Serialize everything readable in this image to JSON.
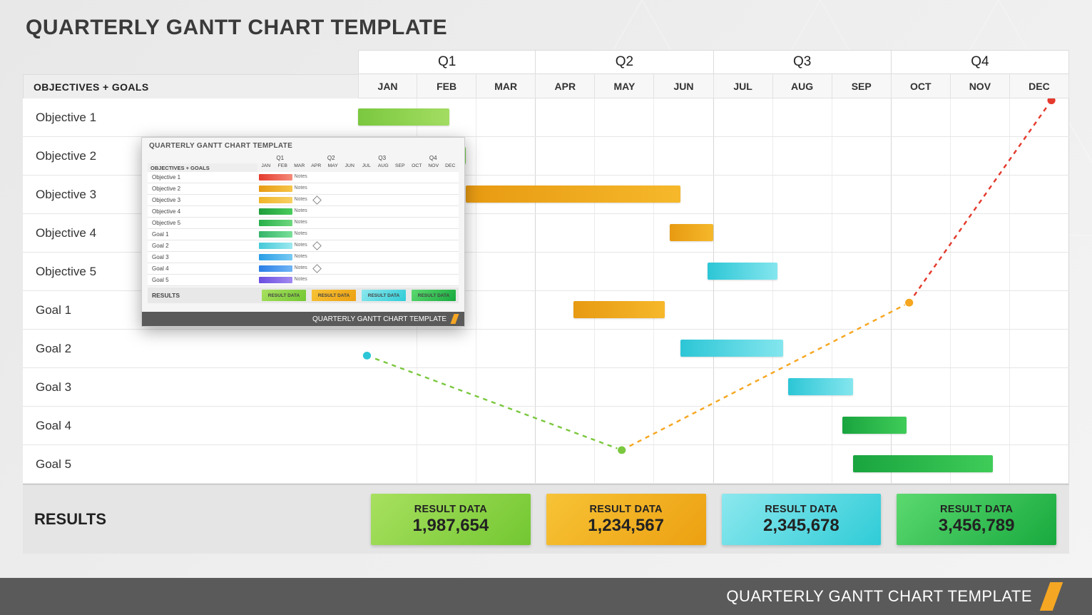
{
  "title": "QUARTERLY GANTT CHART TEMPLATE",
  "footer_title": "QUARTERLY GANTT CHART TEMPLATE",
  "header": {
    "quarters": [
      "Q1",
      "Q2",
      "Q3",
      "Q4"
    ],
    "months": [
      "JAN",
      "FEB",
      "MAR",
      "APR",
      "MAY",
      "JUN",
      "JUL",
      "AUG",
      "SEP",
      "OCT",
      "NOV",
      "DEC"
    ],
    "row_label_header": "OBJECTIVES + GOALS"
  },
  "rows": [
    {
      "label": "Objective 1",
      "bar": {
        "start": 0,
        "span": 1.7,
        "color": "c-green1"
      }
    },
    {
      "label": "Objective 2",
      "bar": {
        "start": 1.3,
        "span": 0.7,
        "color": "c-green2"
      }
    },
    {
      "label": "Objective 3",
      "bar": {
        "start": 2.0,
        "span": 4.0,
        "color": "c-orange"
      }
    },
    {
      "label": "Objective 4",
      "bar": {
        "start": 5.8,
        "span": 0.8,
        "color": "c-orange"
      }
    },
    {
      "label": "Objective 5",
      "bar": {
        "start": 6.5,
        "span": 1.3,
        "color": "c-cyan"
      }
    },
    {
      "label": "Goal 1",
      "bar": {
        "start": 4.0,
        "span": 1.7,
        "color": "c-orange"
      }
    },
    {
      "label": "Goal 2",
      "bar": {
        "start": 6.0,
        "span": 1.9,
        "color": "c-cyan"
      }
    },
    {
      "label": "Goal 3",
      "bar": {
        "start": 8.0,
        "span": 1.2,
        "color": "c-cyan"
      }
    },
    {
      "label": "Goal 4",
      "bar": {
        "start": 9.0,
        "span": 1.2,
        "color": "c-greenD"
      }
    },
    {
      "label": "Goal 5",
      "bar": {
        "start": 9.2,
        "span": 2.6,
        "color": "c-greenD"
      }
    }
  ],
  "results": {
    "label": "RESULTS",
    "boxes": [
      {
        "title": "RESULT DATA",
        "value": "1,987,654",
        "cls": "rb-green"
      },
      {
        "title": "RESULT DATA",
        "value": "1,234,567",
        "cls": "rb-orange"
      },
      {
        "title": "RESULT DATA",
        "value": "2,345,678",
        "cls": "rb-cyan"
      },
      {
        "title": "RESULT DATA",
        "value": "3,456,789",
        "cls": "rb-greenD"
      }
    ]
  },
  "trend_points": [
    {
      "month": 0.15,
      "row": 6.8,
      "color": "#2cc6d6"
    },
    {
      "month": 4.45,
      "row": 9.3,
      "color": "#7bc83f"
    },
    {
      "month": 9.3,
      "row": 5.4,
      "color": "#f6a61f"
    },
    {
      "month": 11.7,
      "row": 0.05,
      "color": "#e43b2e"
    }
  ],
  "thumb": {
    "title": "QUARTERLY GANTT CHART TEMPLATE",
    "footer": "QUARTERLY GANTT CHART TEMPLATE",
    "row_label_header": "OBJECTIVES + GOALS",
    "quarters": [
      "Q1",
      "Q2",
      "Q3",
      "Q4"
    ],
    "months": [
      "JAN",
      "FEB",
      "MAR",
      "APR",
      "MAY",
      "JUN",
      "JUL",
      "AUG",
      "SEP",
      "OCT",
      "NOV",
      "DEC"
    ],
    "rows": [
      {
        "label": "Objective 1",
        "bar": {
          "start": 0,
          "span": 2,
          "grad": "linear-gradient(90deg,#e43b2e,#f58a7a)"
        },
        "note": "Notes"
      },
      {
        "label": "Objective 2",
        "bar": {
          "start": 0,
          "span": 2,
          "grad": "linear-gradient(90deg,#e79a12,#f6c548)"
        },
        "note": "Notes"
      },
      {
        "label": "Objective 3",
        "bar": {
          "start": 0,
          "span": 2,
          "grad": "linear-gradient(90deg,#f0b428,#f7d063)"
        },
        "note": "Notes",
        "diamond": true
      },
      {
        "label": "Objective 4",
        "bar": {
          "start": 0,
          "span": 2,
          "grad": "linear-gradient(90deg,#1f9e3b,#49cc5c)"
        },
        "note": "Notes"
      },
      {
        "label": "Objective 5",
        "bar": {
          "start": 0,
          "span": 2,
          "grad": "linear-gradient(90deg,#27b04a,#6fd77e)"
        },
        "note": "Notes"
      },
      {
        "label": "Goal 1",
        "bar": {
          "start": 0,
          "span": 2,
          "grad": "linear-gradient(90deg,#35b56a,#7adf99)"
        },
        "note": "Notes"
      },
      {
        "label": "Goal 2",
        "bar": {
          "start": 0,
          "span": 2,
          "grad": "linear-gradient(90deg,#44c9d8,#9ce9ef)"
        },
        "note": "Notes",
        "diamond": true
      },
      {
        "label": "Goal 3",
        "bar": {
          "start": 0,
          "span": 2,
          "grad": "linear-gradient(90deg,#2a9ee6,#78caf3)"
        },
        "note": "Notes"
      },
      {
        "label": "Goal 4",
        "bar": {
          "start": 0,
          "span": 2,
          "grad": "linear-gradient(90deg,#2a7de6,#6fb4f5)"
        },
        "note": "Notes",
        "diamond": true
      },
      {
        "label": "Goal 5",
        "bar": {
          "start": 0,
          "span": 2,
          "grad": "linear-gradient(90deg,#6a4de0,#a28af0)"
        },
        "note": "Notes"
      }
    ],
    "results": {
      "label": "RESULTS",
      "boxes": [
        {
          "t": "RESULT DATA",
          "cls": "rb-green"
        },
        {
          "t": "RESULT DATA",
          "cls": "rb-orange"
        },
        {
          "t": "RESULT DATA",
          "cls": "rb-cyan"
        },
        {
          "t": "RESULT DATA",
          "cls": "rb-greenD"
        }
      ]
    }
  },
  "chart_data": {
    "type": "gantt",
    "time_axis": {
      "unit": "month",
      "labels": [
        "JAN",
        "FEB",
        "MAR",
        "APR",
        "MAY",
        "JUN",
        "JUL",
        "AUG",
        "SEP",
        "OCT",
        "NOV",
        "DEC"
      ],
      "range": [
        0,
        12
      ]
    },
    "quarters": [
      "Q1",
      "Q2",
      "Q3",
      "Q4"
    ],
    "tasks": [
      {
        "name": "Objective 1",
        "start": 0.0,
        "end": 1.7,
        "color": "#8ccf44"
      },
      {
        "name": "Objective 2",
        "start": 1.3,
        "end": 2.0,
        "color": "#4fb84f"
      },
      {
        "name": "Objective 3",
        "start": 2.0,
        "end": 6.0,
        "color": "#f1aa1d"
      },
      {
        "name": "Objective 4",
        "start": 5.8,
        "end": 6.6,
        "color": "#f1aa1d"
      },
      {
        "name": "Objective 5",
        "start": 6.5,
        "end": 7.8,
        "color": "#4bd3de"
      },
      {
        "name": "Goal 1",
        "start": 4.0,
        "end": 5.7,
        "color": "#f1aa1d"
      },
      {
        "name": "Goal 2",
        "start": 6.0,
        "end": 7.9,
        "color": "#4bd3de"
      },
      {
        "name": "Goal 3",
        "start": 8.0,
        "end": 9.2,
        "color": "#6ae0e9"
      },
      {
        "name": "Goal 4",
        "start": 9.0,
        "end": 10.2,
        "color": "#2fb64c"
      },
      {
        "name": "Goal 5",
        "start": 9.2,
        "end": 11.8,
        "color": "#2fb64c"
      }
    ],
    "results_per_quarter": [
      {
        "quarter": "Q1",
        "label": "RESULT DATA",
        "value": 1987654
      },
      {
        "quarter": "Q2",
        "label": "RESULT DATA",
        "value": 1234567
      },
      {
        "quarter": "Q3",
        "label": "RESULT DATA",
        "value": 2345678
      },
      {
        "quarter": "Q4",
        "label": "RESULT DATA",
        "value": 3456789
      }
    ],
    "trend_markers": [
      {
        "x_month": 0.15,
        "y_row": 6.8
      },
      {
        "x_month": 4.45,
        "y_row": 9.3
      },
      {
        "x_month": 9.3,
        "y_row": 5.4
      },
      {
        "x_month": 11.7,
        "y_row": 0.05
      }
    ]
  }
}
